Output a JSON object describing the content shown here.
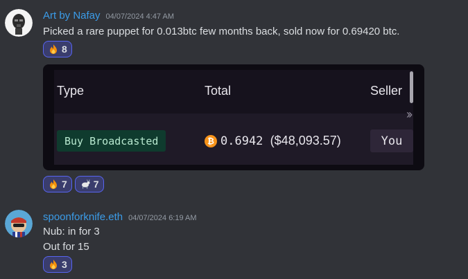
{
  "messages": [
    {
      "author": "Art by Nafay",
      "timestamp": "04/07/2024 4:47 AM",
      "text": "Picked a rare puppet for 0.013btc few months back, sold now for 0.69420 btc.",
      "reactions": [
        {
          "emoji": "fire",
          "count": "8"
        }
      ],
      "embed": {
        "headers": {
          "type": "Type",
          "total": "Total",
          "seller": "Seller"
        },
        "row": {
          "type": "Buy Broadcasted",
          "btc_symbol": "₿",
          "amount": "0.6942",
          "usd": "($48,093.57)",
          "seller": "You"
        },
        "more_icon": "chevrons-right-icon"
      },
      "embed_reactions": [
        {
          "emoji": "fire",
          "count": "7"
        },
        {
          "emoji": "goat",
          "count": "7"
        }
      ]
    },
    {
      "author": "spoonforknife.eth",
      "timestamp": "04/07/2024 6:19 AM",
      "lines": [
        "Nub: in for 3",
        "Out for 15"
      ],
      "reactions": [
        {
          "emoji": "fire",
          "count": "3"
        }
      ]
    }
  ],
  "colors": {
    "background": "#313338",
    "author": "#3b9ce8",
    "reaction_bg": "#3a3d6d",
    "reaction_border": "#5865f2",
    "status_green": "#0f3b2e",
    "btc_orange": "#f7931a"
  }
}
